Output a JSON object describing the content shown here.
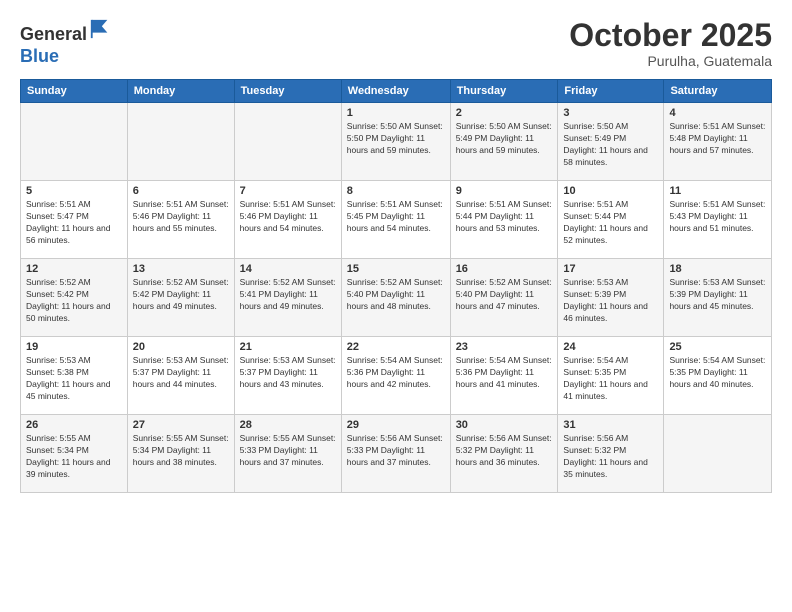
{
  "header": {
    "logo": {
      "line1": "General",
      "line2": "Blue"
    },
    "title": "October 2025",
    "subtitle": "Purulha, Guatemala"
  },
  "weekdays": [
    "Sunday",
    "Monday",
    "Tuesday",
    "Wednesday",
    "Thursday",
    "Friday",
    "Saturday"
  ],
  "weeks": [
    [
      {
        "day": "",
        "info": ""
      },
      {
        "day": "",
        "info": ""
      },
      {
        "day": "",
        "info": ""
      },
      {
        "day": "1",
        "info": "Sunrise: 5:50 AM\nSunset: 5:50 PM\nDaylight: 11 hours\nand 59 minutes."
      },
      {
        "day": "2",
        "info": "Sunrise: 5:50 AM\nSunset: 5:49 PM\nDaylight: 11 hours\nand 59 minutes."
      },
      {
        "day": "3",
        "info": "Sunrise: 5:50 AM\nSunset: 5:49 PM\nDaylight: 11 hours\nand 58 minutes."
      },
      {
        "day": "4",
        "info": "Sunrise: 5:51 AM\nSunset: 5:48 PM\nDaylight: 11 hours\nand 57 minutes."
      }
    ],
    [
      {
        "day": "5",
        "info": "Sunrise: 5:51 AM\nSunset: 5:47 PM\nDaylight: 11 hours\nand 56 minutes."
      },
      {
        "day": "6",
        "info": "Sunrise: 5:51 AM\nSunset: 5:46 PM\nDaylight: 11 hours\nand 55 minutes."
      },
      {
        "day": "7",
        "info": "Sunrise: 5:51 AM\nSunset: 5:46 PM\nDaylight: 11 hours\nand 54 minutes."
      },
      {
        "day": "8",
        "info": "Sunrise: 5:51 AM\nSunset: 5:45 PM\nDaylight: 11 hours\nand 54 minutes."
      },
      {
        "day": "9",
        "info": "Sunrise: 5:51 AM\nSunset: 5:44 PM\nDaylight: 11 hours\nand 53 minutes."
      },
      {
        "day": "10",
        "info": "Sunrise: 5:51 AM\nSunset: 5:44 PM\nDaylight: 11 hours\nand 52 minutes."
      },
      {
        "day": "11",
        "info": "Sunrise: 5:51 AM\nSunset: 5:43 PM\nDaylight: 11 hours\nand 51 minutes."
      }
    ],
    [
      {
        "day": "12",
        "info": "Sunrise: 5:52 AM\nSunset: 5:42 PM\nDaylight: 11 hours\nand 50 minutes."
      },
      {
        "day": "13",
        "info": "Sunrise: 5:52 AM\nSunset: 5:42 PM\nDaylight: 11 hours\nand 49 minutes."
      },
      {
        "day": "14",
        "info": "Sunrise: 5:52 AM\nSunset: 5:41 PM\nDaylight: 11 hours\nand 49 minutes."
      },
      {
        "day": "15",
        "info": "Sunrise: 5:52 AM\nSunset: 5:40 PM\nDaylight: 11 hours\nand 48 minutes."
      },
      {
        "day": "16",
        "info": "Sunrise: 5:52 AM\nSunset: 5:40 PM\nDaylight: 11 hours\nand 47 minutes."
      },
      {
        "day": "17",
        "info": "Sunrise: 5:53 AM\nSunset: 5:39 PM\nDaylight: 11 hours\nand 46 minutes."
      },
      {
        "day": "18",
        "info": "Sunrise: 5:53 AM\nSunset: 5:39 PM\nDaylight: 11 hours\nand 45 minutes."
      }
    ],
    [
      {
        "day": "19",
        "info": "Sunrise: 5:53 AM\nSunset: 5:38 PM\nDaylight: 11 hours\nand 45 minutes."
      },
      {
        "day": "20",
        "info": "Sunrise: 5:53 AM\nSunset: 5:37 PM\nDaylight: 11 hours\nand 44 minutes."
      },
      {
        "day": "21",
        "info": "Sunrise: 5:53 AM\nSunset: 5:37 PM\nDaylight: 11 hours\nand 43 minutes."
      },
      {
        "day": "22",
        "info": "Sunrise: 5:54 AM\nSunset: 5:36 PM\nDaylight: 11 hours\nand 42 minutes."
      },
      {
        "day": "23",
        "info": "Sunrise: 5:54 AM\nSunset: 5:36 PM\nDaylight: 11 hours\nand 41 minutes."
      },
      {
        "day": "24",
        "info": "Sunrise: 5:54 AM\nSunset: 5:35 PM\nDaylight: 11 hours\nand 41 minutes."
      },
      {
        "day": "25",
        "info": "Sunrise: 5:54 AM\nSunset: 5:35 PM\nDaylight: 11 hours\nand 40 minutes."
      }
    ],
    [
      {
        "day": "26",
        "info": "Sunrise: 5:55 AM\nSunset: 5:34 PM\nDaylight: 11 hours\nand 39 minutes."
      },
      {
        "day": "27",
        "info": "Sunrise: 5:55 AM\nSunset: 5:34 PM\nDaylight: 11 hours\nand 38 minutes."
      },
      {
        "day": "28",
        "info": "Sunrise: 5:55 AM\nSunset: 5:33 PM\nDaylight: 11 hours\nand 37 minutes."
      },
      {
        "day": "29",
        "info": "Sunrise: 5:56 AM\nSunset: 5:33 PM\nDaylight: 11 hours\nand 37 minutes."
      },
      {
        "day": "30",
        "info": "Sunrise: 5:56 AM\nSunset: 5:32 PM\nDaylight: 11 hours\nand 36 minutes."
      },
      {
        "day": "31",
        "info": "Sunrise: 5:56 AM\nSunset: 5:32 PM\nDaylight: 11 hours\nand 35 minutes."
      },
      {
        "day": "",
        "info": ""
      }
    ]
  ]
}
